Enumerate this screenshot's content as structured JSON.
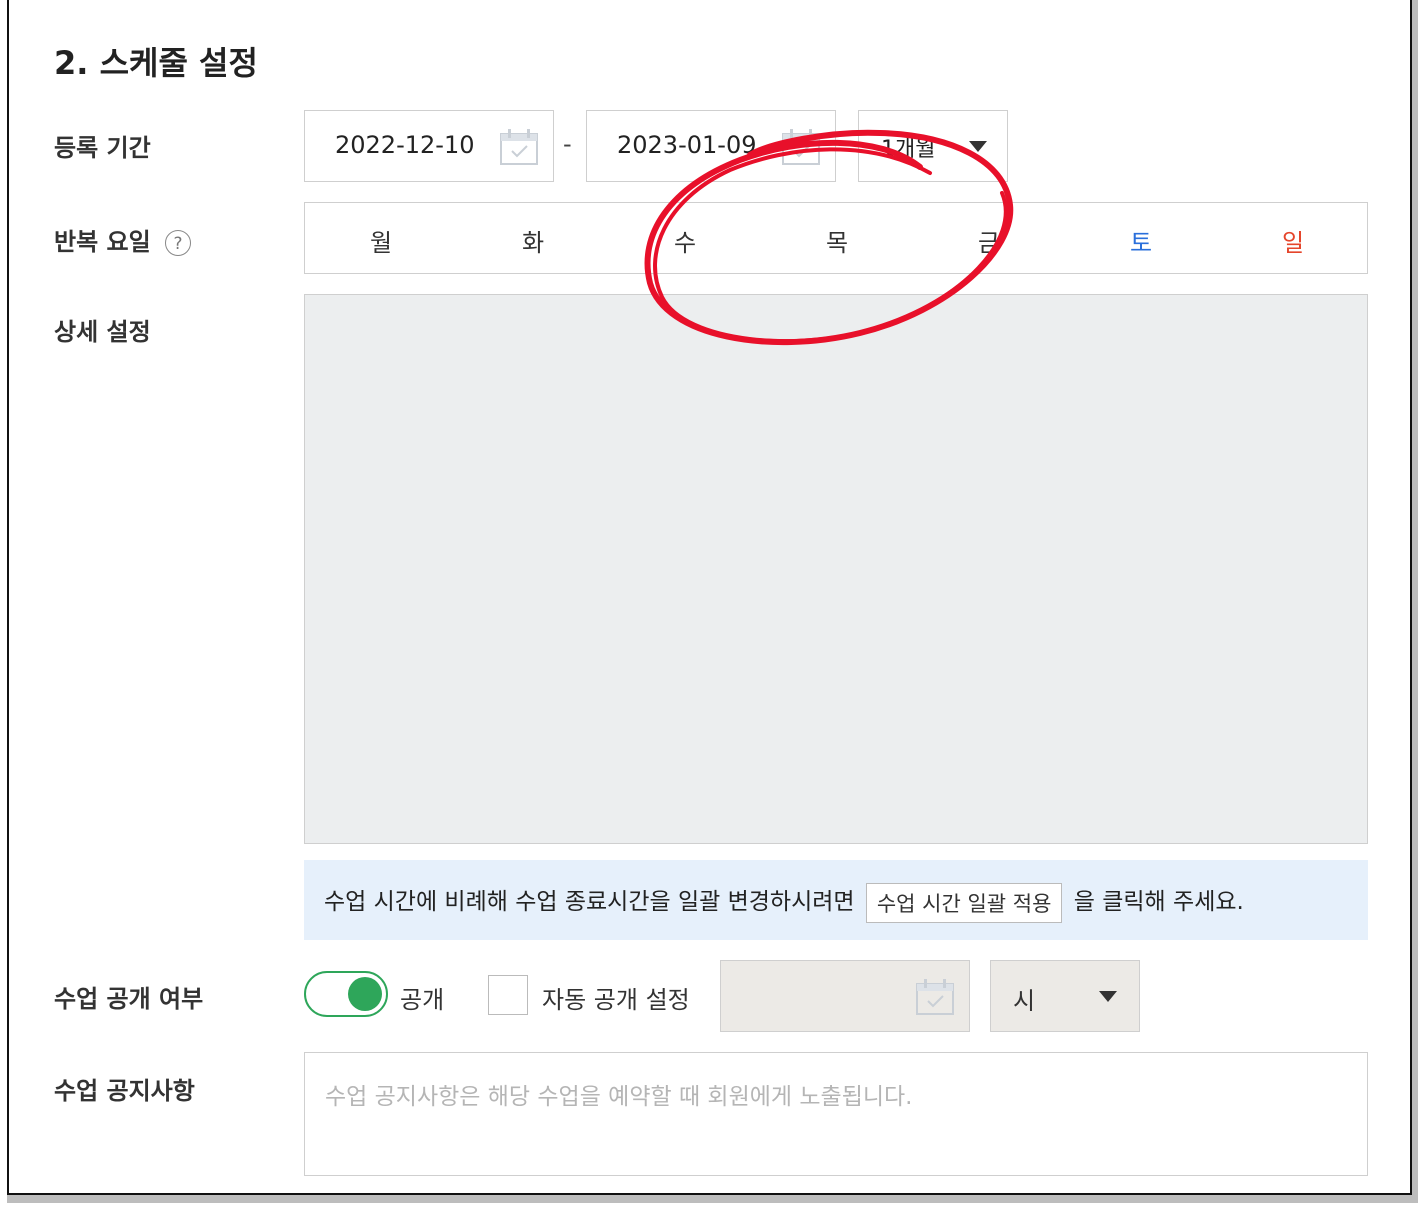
{
  "section": {
    "title": "2. 스케줄 설정"
  },
  "registration_period": {
    "label": "등록 기간",
    "start_date": "2022-12-10",
    "end_date": "2023-01-09",
    "separator": "-",
    "duration_select": {
      "value": "1개월",
      "icon": "chevron-down-icon"
    },
    "calendar_icon": "calendar-icon"
  },
  "repeat_days": {
    "label": "반복 요일",
    "help_icon": "?",
    "days": [
      {
        "label": "월",
        "color": "#333333"
      },
      {
        "label": "화",
        "color": "#333333"
      },
      {
        "label": "수",
        "color": "#333333"
      },
      {
        "label": "목",
        "color": "#333333"
      },
      {
        "label": "금",
        "color": "#333333"
      },
      {
        "label": "토",
        "color": "#2a6fdb"
      },
      {
        "label": "일",
        "color": "#e5452b"
      }
    ]
  },
  "detail_settings": {
    "label": "상세 설정"
  },
  "info_bar": {
    "text_before": "수업 시간에 비례해 수업 종료시간을 일괄 변경하시려면",
    "button_label": "수업 시간 일괄 적용",
    "text_after": "을 클릭해 주세요."
  },
  "visibility": {
    "label": "수업 공개 여부",
    "toggle_on": true,
    "toggle_label": "공개",
    "auto_publish_checked": false,
    "auto_publish_label": "자동 공개 설정",
    "hour_select": {
      "value": "시"
    }
  },
  "notice": {
    "label": "수업 공지사항",
    "placeholder": "수업 공지사항은 해당 수업을 예약할 때 회원에게 노출됩니다.",
    "value": ""
  },
  "colors": {
    "accent_green": "#2ea65a",
    "annotation_red": "#e8102a",
    "info_bg": "#e6f0fb",
    "disabled_bg": "#eceae6"
  }
}
